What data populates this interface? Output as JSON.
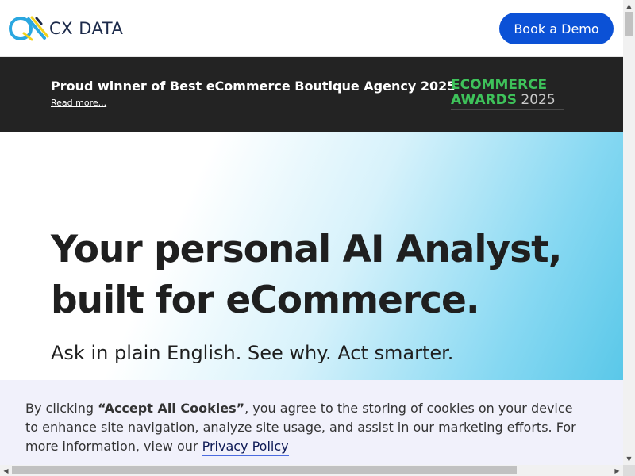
{
  "header": {
    "logo_text": "CX DATA",
    "cta_label": "Book a Demo"
  },
  "banner": {
    "title": "Proud winner of Best eCommerce Boutique Agency 2025",
    "link": "Read more...",
    "award": {
      "line1": "ECOMMERCE",
      "line2_word": "AWARDS",
      "line2_year": "2025"
    }
  },
  "hero": {
    "title_line1": "Your personal AI Analyst,",
    "title_line2": "built for eCommerce.",
    "subtitle": "Ask in plain English. See why. Act smarter."
  },
  "cookie": {
    "text_before": "By clicking ",
    "strong": "“Accept All Cookies”",
    "text_after": ", you agree to the storing of cookies on your device to enhance site navigation, analyze site usage, and assist in our marketing efforts. For more information, view our ",
    "link": "Privacy Policy"
  },
  "colors": {
    "brand_blue": "#0b51d6",
    "banner_bg": "#232323",
    "award_green": "#3ec25a",
    "cookie_bg": "#f1f1fb"
  },
  "icons": {
    "logo": "cx-data-logo-mark",
    "scroll_up": "chevron-up-icon",
    "scroll_down": "chevron-down-icon",
    "scroll_left": "chevron-left-icon",
    "scroll_right": "chevron-right-icon"
  }
}
